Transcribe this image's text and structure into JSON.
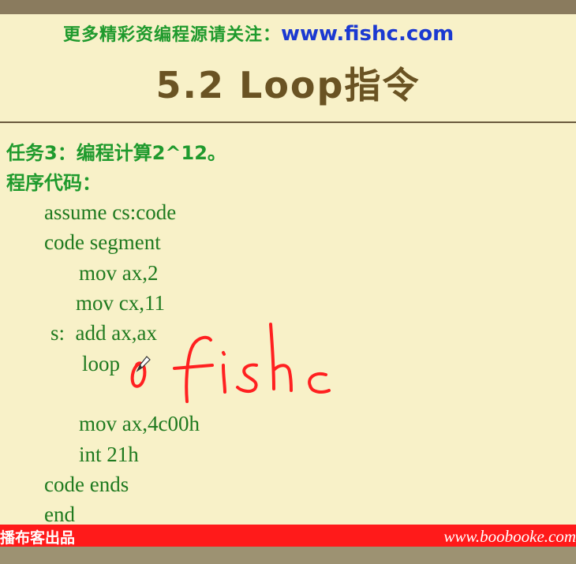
{
  "promo": {
    "text": "更多精彩资编程源请关注：",
    "url": "www.fishc.com"
  },
  "slide": {
    "title": "5.2 Loop指令"
  },
  "task": {
    "label": "任务3：编程计算2^12。"
  },
  "code_label": "程序代码：",
  "code": [
    "assume cs:code",
    "code segment",
    "mov ax,2",
    "mov cx,11",
    "s:  add ax,ax",
    "loop",
    "mov ax,4c00h",
    "int 21h",
    "code ends",
    "end"
  ],
  "annotation": {
    "handwriting": "0 fishc",
    "color": "#ff2020"
  },
  "bottom_bar": {
    "brand": "播布客出品",
    "site": "www.boobooke.com"
  },
  "colors": {
    "background": "#f8f1c8",
    "green": "#1f9a2d",
    "blue": "#1b39d1",
    "red_bar": "#ff1a1a",
    "title_brown": "#6a5323"
  },
  "icons": {
    "cursor": "pen-cursor-icon"
  }
}
